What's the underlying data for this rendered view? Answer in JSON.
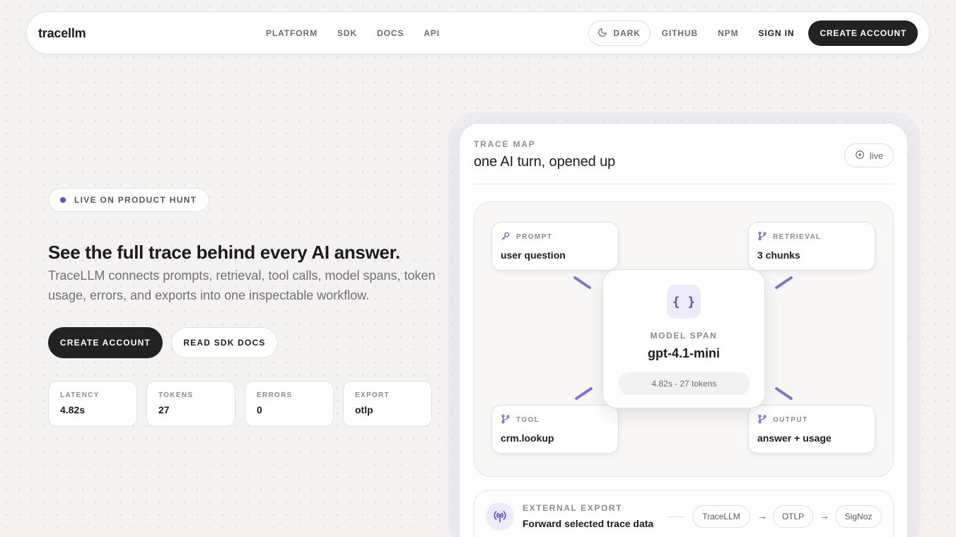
{
  "nav": {
    "brand": "tracellm",
    "links": [
      "PLATFORM",
      "SDK",
      "DOCS",
      "API"
    ],
    "theme_label": "DARK",
    "github": "GITHUB",
    "npm": "NPM",
    "signin": "SIGN IN",
    "cta": "CREATE ACCOUNT"
  },
  "hero": {
    "badge": "LIVE ON PRODUCT HUNT",
    "title": "See the full trace behind every AI answer.",
    "subtitle": "TraceLLM connects prompts, retrieval, tool calls, model spans, token usage, errors, and exports into one inspectable workflow.",
    "primary_cta": "CREATE ACCOUNT",
    "secondary_cta": "READ SDK DOCS",
    "stats": [
      {
        "label": "LATENCY",
        "value": "4.82s"
      },
      {
        "label": "TOKENS",
        "value": "27"
      },
      {
        "label": "ERRORS",
        "value": "0"
      },
      {
        "label": "EXPORT",
        "value": "otlp"
      }
    ]
  },
  "trace_map": {
    "eyebrow": "TRACE MAP",
    "title": "one AI turn, opened up",
    "live_label": "live",
    "nodes": {
      "prompt": {
        "label": "PROMPT",
        "value": "user question"
      },
      "retrieval": {
        "label": "RETRIEVAL",
        "value": "3 chunks"
      },
      "tool": {
        "label": "TOOL",
        "value": "crm.lookup"
      },
      "output": {
        "label": "OUTPUT",
        "value": "answer + usage"
      }
    },
    "center": {
      "icon_glyph": "{ }",
      "eyebrow": "MODEL SPAN",
      "model": "gpt-4.1-mini",
      "meta": "4.82s - 27 tokens"
    },
    "export": {
      "eyebrow": "EXTERNAL EXPORT",
      "title": "Forward selected trace data",
      "chips": [
        "TraceLLM",
        "OTLP",
        "SigNoz"
      ],
      "arrow": "→"
    }
  },
  "colors": {
    "accent": "#5b4ed6",
    "connector": "#7d6fe6",
    "dark_button": "#222222",
    "background": "#f4f3f1"
  }
}
